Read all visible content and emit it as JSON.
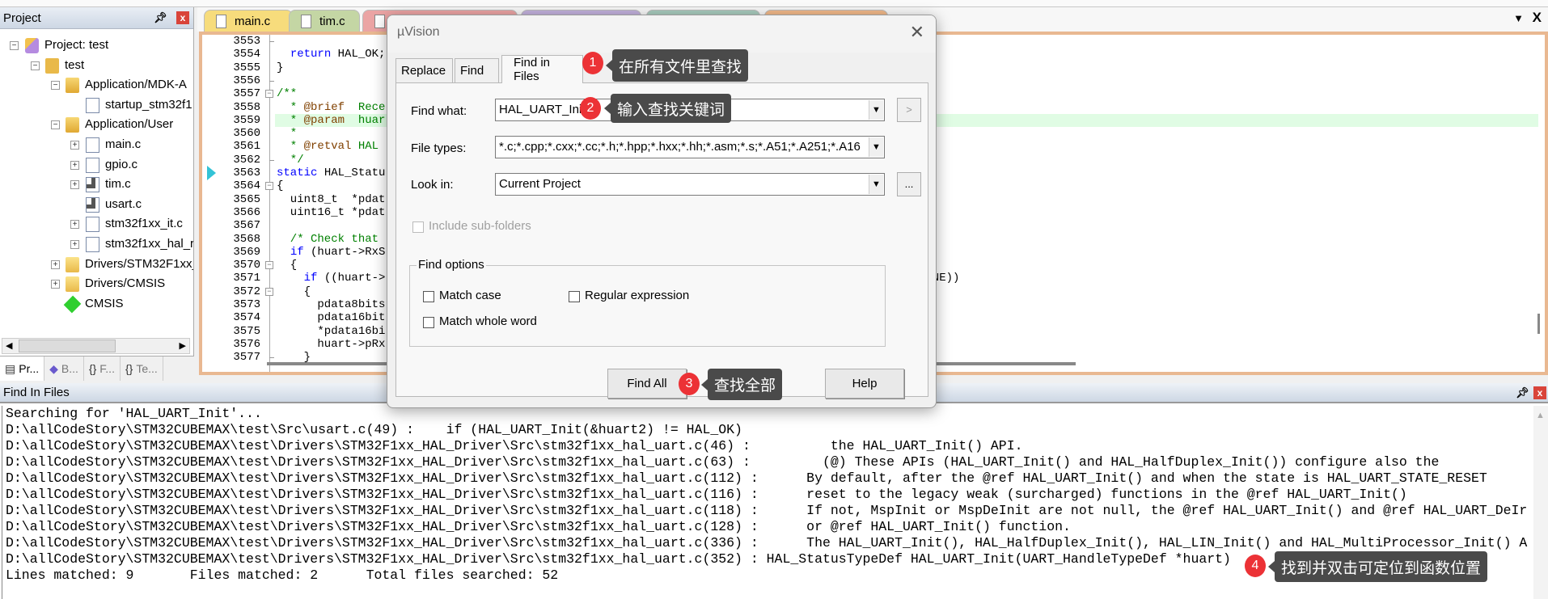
{
  "project_pane": {
    "title": "Project",
    "tree": [
      {
        "label": "Project: test",
        "level": 0,
        "expander": "-",
        "icon": "project-icon"
      },
      {
        "label": "test",
        "level": 1,
        "expander": "-",
        "icon": "target-folder-icon"
      },
      {
        "label": "Application/MDK-A",
        "level": 2,
        "expander": "-",
        "icon": "folder-open-icon"
      },
      {
        "label": "startup_stm32f1",
        "level": 3,
        "expander": "",
        "icon": "file-icon"
      },
      {
        "label": "Application/User",
        "level": 2,
        "expander": "-",
        "icon": "folder-open-icon"
      },
      {
        "label": "main.c",
        "level": 3,
        "expander": "+",
        "icon": "file-icon"
      },
      {
        "label": "gpio.c",
        "level": 3,
        "expander": "+",
        "icon": "file-icon"
      },
      {
        "label": "tim.c",
        "level": 3,
        "expander": "+",
        "icon": "file-gear-icon"
      },
      {
        "label": "usart.c",
        "level": 3,
        "expander": "",
        "icon": "file-gear-icon"
      },
      {
        "label": "stm32f1xx_it.c",
        "level": 3,
        "expander": "+",
        "icon": "file-icon"
      },
      {
        "label": "stm32f1xx_hal_r",
        "level": 3,
        "expander": "+",
        "icon": "file-icon"
      },
      {
        "label": "Drivers/STM32F1xx_",
        "level": 2,
        "expander": "+",
        "icon": "folder-closed-icon"
      },
      {
        "label": "Drivers/CMSIS",
        "level": 2,
        "expander": "+",
        "icon": "folder-closed-icon"
      },
      {
        "label": "CMSIS",
        "level": 2,
        "expander": "",
        "icon": "cmsis-diamond-icon"
      }
    ],
    "bottom_tabs": [
      {
        "label": "Pr...",
        "icon": "project-tab-icon"
      },
      {
        "label": "B...",
        "icon": "books-icon"
      },
      {
        "label": "F...",
        "icon": "braces-icon"
      },
      {
        "label": "Te...",
        "icon": "templates-icon"
      }
    ]
  },
  "editor": {
    "tabs": [
      {
        "label": "main.c",
        "color": "#f7dc7c"
      },
      {
        "label": "tim.c",
        "color": "#c4d6a4"
      },
      {
        "label": "",
        "color": "#eba4a4"
      },
      {
        "label": "",
        "color": "#c2b0dc"
      },
      {
        "label": "",
        "color": "#a8cbbd"
      },
      {
        "label": "",
        "color": "#f2b98a"
      }
    ],
    "highlight_color": "#e0fce4",
    "current_line": 3563,
    "highlight_line": 3559,
    "lines": [
      {
        "n": 3553,
        "fold": "end",
        "seg": []
      },
      {
        "n": 3554,
        "fold": "",
        "seg": [
          [
            "  ",
            ""
          ],
          [
            "return",
            "k"
          ],
          [
            " HAL_OK;",
            ""
          ]
        ]
      },
      {
        "n": 3555,
        "fold": "",
        "seg": [
          [
            "}",
            ""
          ]
        ]
      },
      {
        "n": 3556,
        "fold": "end",
        "seg": []
      },
      {
        "n": 3557,
        "fold": "box",
        "seg": [
          [
            "/**",
            "c"
          ]
        ]
      },
      {
        "n": 3558,
        "fold": "",
        "seg": [
          [
            "  * ",
            "c"
          ],
          [
            "@brief",
            "t"
          ],
          [
            "  Rece",
            "c"
          ]
        ]
      },
      {
        "n": 3559,
        "fold": "",
        "seg": [
          [
            "  * ",
            "c"
          ],
          [
            "@param",
            "t"
          ],
          [
            "  huar",
            "c"
          ]
        ]
      },
      {
        "n": 3560,
        "fold": "",
        "seg": [
          [
            "  *",
            "c"
          ]
        ]
      },
      {
        "n": 3561,
        "fold": "",
        "seg": [
          [
            "  * ",
            "c"
          ],
          [
            "@retval",
            "t"
          ],
          [
            " HAL",
            "c"
          ]
        ]
      },
      {
        "n": 3562,
        "fold": "end",
        "seg": [
          [
            "  */",
            "c"
          ]
        ]
      },
      {
        "n": 3563,
        "fold": "",
        "seg": [
          [
            "static",
            "k"
          ],
          [
            " HAL_Statu",
            ""
          ]
        ]
      },
      {
        "n": 3564,
        "fold": "box",
        "seg": [
          [
            "{",
            ""
          ]
        ]
      },
      {
        "n": 3565,
        "fold": "",
        "seg": [
          [
            "  uint8_t  *pdat",
            ""
          ]
        ]
      },
      {
        "n": 3566,
        "fold": "",
        "seg": [
          [
            "  uint16_t *pdat",
            ""
          ]
        ]
      },
      {
        "n": 3567,
        "fold": "",
        "seg": []
      },
      {
        "n": 3568,
        "fold": "",
        "seg": [
          [
            "  /* Check that",
            "c"
          ]
        ]
      },
      {
        "n": 3569,
        "fold": "",
        "seg": [
          [
            "  ",
            ""
          ],
          [
            "if",
            "k"
          ],
          [
            " (huart->RxS",
            ""
          ]
        ]
      },
      {
        "n": 3570,
        "fold": "box",
        "seg": [
          [
            "  {",
            ""
          ]
        ]
      },
      {
        "n": 3571,
        "fold": "",
        "seg": [
          [
            "    ",
            ""
          ],
          [
            "if",
            "k"
          ],
          [
            " ((huart->",
            ""
          ]
        ],
        "right": "NONE))"
      },
      {
        "n": 3572,
        "fold": "box",
        "seg": [
          [
            "    {",
            ""
          ]
        ]
      },
      {
        "n": 3573,
        "fold": "",
        "seg": [
          [
            "      pdata8bits",
            ""
          ]
        ]
      },
      {
        "n": 3574,
        "fold": "",
        "seg": [
          [
            "      pdata16bit",
            ""
          ]
        ]
      },
      {
        "n": 3575,
        "fold": "",
        "seg": [
          [
            "      *pdata16bi",
            ""
          ]
        ]
      },
      {
        "n": 3576,
        "fold": "",
        "seg": [
          [
            "      huart->pRx",
            ""
          ]
        ]
      },
      {
        "n": 3577,
        "fold": "end",
        "seg": [
          [
            "    }",
            ""
          ]
        ]
      }
    ]
  },
  "dialog": {
    "title": "µVision",
    "tabs": [
      "Replace",
      "Find",
      "Find in Files"
    ],
    "active_tab": "Find in Files",
    "find_what_label": "Find what:",
    "find_what_value": "HAL_UART_Init",
    "find_next_label": ">",
    "file_types_label": "File types:",
    "file_types_value": "*.c;*.cpp;*.cxx;*.cc;*.h;*.hpp;*.hxx;*.hh;*.asm;*.s;*.A51;*.A251;*.A16",
    "look_in_label": "Look in:",
    "look_in_value": "Current Project",
    "browse_label": "...",
    "include_subfolders": {
      "label": "Include sub-folders",
      "checked": false,
      "disabled": true
    },
    "find_options_label": "Find options",
    "options": {
      "match_case": {
        "label": "Match case",
        "checked": false
      },
      "regular_expression": {
        "label": "Regular expression",
        "checked": false
      },
      "match_whole_word": {
        "label": "Match whole word",
        "checked": false
      }
    },
    "find_all_label": "Find All",
    "help_label": "Help"
  },
  "annotations": [
    {
      "num": "1",
      "text": "在所有文件里查找"
    },
    {
      "num": "2",
      "text": "输入查找关键词"
    },
    {
      "num": "3",
      "text": "查找全部"
    },
    {
      "num": "4",
      "text": "找到并双击可定位到函数位置"
    }
  ],
  "output_panel": {
    "title": "Find In Files",
    "lines": [
      "Searching for 'HAL_UART_Init'...",
      "D:\\allCodeStory\\STM32CUBEMAX\\test\\Src\\usart.c(49) :    if (HAL_UART_Init(&huart2) != HAL_OK)",
      "D:\\allCodeStory\\STM32CUBEMAX\\test\\Drivers\\STM32F1xx_HAL_Driver\\Src\\stm32f1xx_hal_uart.c(46) :          the HAL_UART_Init() API.",
      "D:\\allCodeStory\\STM32CUBEMAX\\test\\Drivers\\STM32F1xx_HAL_Driver\\Src\\stm32f1xx_hal_uart.c(63) :         (@) These APIs (HAL_UART_Init() and HAL_HalfDuplex_Init()) configure also the",
      "D:\\allCodeStory\\STM32CUBEMAX\\test\\Drivers\\STM32F1xx_HAL_Driver\\Src\\stm32f1xx_hal_uart.c(112) :      By default, after the @ref HAL_UART_Init() and when the state is HAL_UART_STATE_RESET",
      "D:\\allCodeStory\\STM32CUBEMAX\\test\\Drivers\\STM32F1xx_HAL_Driver\\Src\\stm32f1xx_hal_uart.c(116) :      reset to the legacy weak (surcharged) functions in the @ref HAL_UART_Init()",
      "D:\\allCodeStory\\STM32CUBEMAX\\test\\Drivers\\STM32F1xx_HAL_Driver\\Src\\stm32f1xx_hal_uart.c(118) :      If not, MspInit or MspDeInit are not null, the @ref HAL_UART_Init() and @ref HAL_UART_DeIr",
      "D:\\allCodeStory\\STM32CUBEMAX\\test\\Drivers\\STM32F1xx_HAL_Driver\\Src\\stm32f1xx_hal_uart.c(128) :      or @ref HAL_UART_Init() function.",
      "D:\\allCodeStory\\STM32CUBEMAX\\test\\Drivers\\STM32F1xx_HAL_Driver\\Src\\stm32f1xx_hal_uart.c(336) :      The HAL_UART_Init(), HAL_HalfDuplex_Init(), HAL_LIN_Init() and HAL_MultiProcessor_Init() A",
      "D:\\allCodeStory\\STM32CUBEMAX\\test\\Drivers\\STM32F1xx_HAL_Driver\\Src\\stm32f1xx_hal_uart.c(352) : HAL_StatusTypeDef HAL_UART_Init(UART_HandleTypeDef *huart)",
      "Lines matched: 9       Files matched: 2      Total files searched: 52"
    ]
  },
  "colors": {
    "badge": "#ec3236",
    "tooltip": "#4a4a4a",
    "editor_border": "#e9b891"
  }
}
